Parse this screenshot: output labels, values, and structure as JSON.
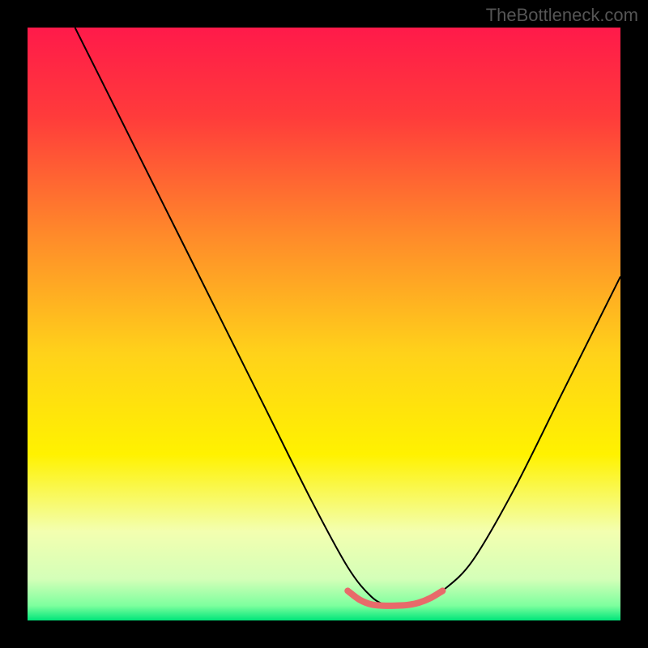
{
  "watermark": "TheBottleneck.com",
  "chart_data": {
    "type": "line",
    "title": "",
    "xlabel": "",
    "ylabel": "",
    "xlim": [
      0,
      100
    ],
    "ylim": [
      0,
      100
    ],
    "grid": false,
    "legend": false,
    "background_gradient_stops": [
      {
        "offset": 0.0,
        "color": "#ff1a4a"
      },
      {
        "offset": 0.15,
        "color": "#ff3b3b"
      },
      {
        "offset": 0.35,
        "color": "#ff8a2a"
      },
      {
        "offset": 0.55,
        "color": "#ffd21a"
      },
      {
        "offset": 0.72,
        "color": "#fff200"
      },
      {
        "offset": 0.85,
        "color": "#f3ffb0"
      },
      {
        "offset": 0.93,
        "color": "#d4ffb8"
      },
      {
        "offset": 0.975,
        "color": "#7dff9e"
      },
      {
        "offset": 1.0,
        "color": "#00e57a"
      }
    ],
    "series": [
      {
        "name": "bottleneck-curve",
        "color": "#000000",
        "width": 2,
        "x": [
          8,
          12,
          18,
          25,
          32,
          40,
          48,
          54,
          58,
          61,
          64,
          67,
          70,
          75,
          82,
          90,
          100
        ],
        "values": [
          100,
          92,
          80,
          66,
          52,
          36,
          20,
          9,
          4,
          2.5,
          2.5,
          3,
          5,
          10,
          22,
          38,
          58
        ]
      },
      {
        "name": "optimal-marker",
        "color": "#e86a6a",
        "width": 8,
        "x": [
          54,
          56,
          58,
          60,
          62,
          64,
          66,
          68,
          70
        ],
        "values": [
          5,
          3.5,
          2.7,
          2.5,
          2.5,
          2.6,
          3,
          3.8,
          5
        ]
      }
    ]
  }
}
